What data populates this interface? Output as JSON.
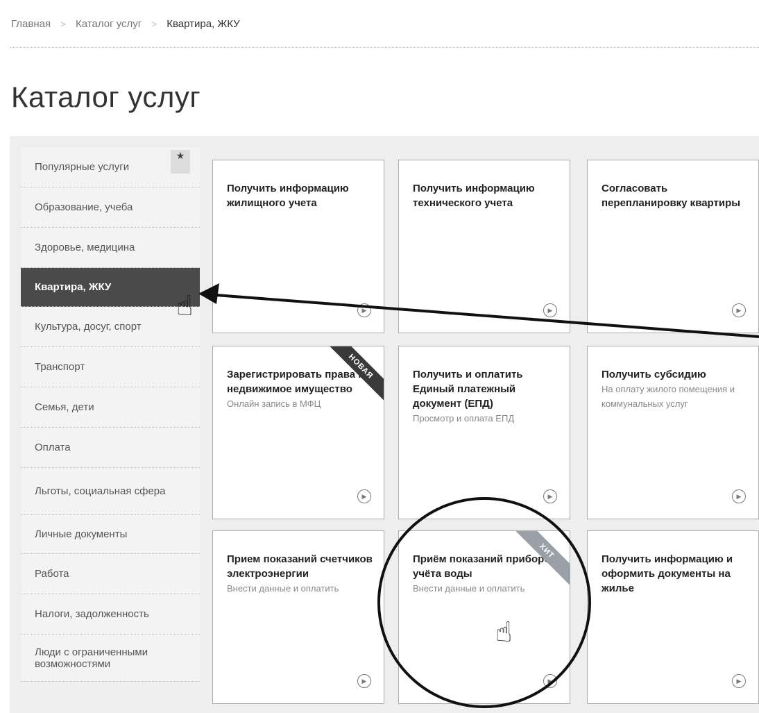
{
  "breadcrumb": {
    "home": "Главная",
    "catalog": "Каталог услуг",
    "current": "Квартира, ЖКУ"
  },
  "page_title": "Каталог услуг",
  "sidebar": {
    "items": [
      {
        "label": "Популярные услуги"
      },
      {
        "label": "Образование, учеба"
      },
      {
        "label": "Здоровье, медицина"
      },
      {
        "label": "Квартира, ЖКУ",
        "active": true
      },
      {
        "label": "Культура, досуг, спорт"
      },
      {
        "label": "Транспорт"
      },
      {
        "label": "Семья, дети"
      },
      {
        "label": "Оплата"
      },
      {
        "label": "Льготы, социальная сфера"
      },
      {
        "label": "Личные документы"
      },
      {
        "label": "Работа"
      },
      {
        "label": "Налоги, задолженность"
      },
      {
        "label": "Люди с ограниченными возможностями"
      }
    ],
    "star": "★"
  },
  "cards": [
    {
      "title": "Получить информацию жилищного учета",
      "subtitle": ""
    },
    {
      "title": "Получить информацию технического учета",
      "subtitle": ""
    },
    {
      "title": "Согласовать перепланировку квартиры",
      "subtitle": ""
    },
    {
      "title": "Зарегистрировать права на недвижимое имущество",
      "subtitle": "Онлайн запись в МФЦ",
      "ribbon": "НОВАЯ",
      "ribbon_color": "#3a3a3a"
    },
    {
      "title": "Получить и оплатить Единый платежный документ (ЕПД)",
      "subtitle": "Просмотр и оплата ЕПД"
    },
    {
      "title": "Получить субсидию",
      "subtitle": "На оплату жилого помещения и коммунальных услуг"
    },
    {
      "title": "Прием показаний счетчиков электроэнергии",
      "subtitle": "Внести данные и оплатить"
    },
    {
      "title": "Приём показаний приборов учёта воды",
      "subtitle": "Внести данные и оплатить",
      "ribbon": "ХИТ",
      "ribbon_color": "#9aa0a8"
    },
    {
      "title": "Получить информацию и оформить документы на жилье",
      "subtitle": ""
    }
  ],
  "icons": {
    "play": "play-circle-icon",
    "pointer": "hand-pointer-icon"
  }
}
